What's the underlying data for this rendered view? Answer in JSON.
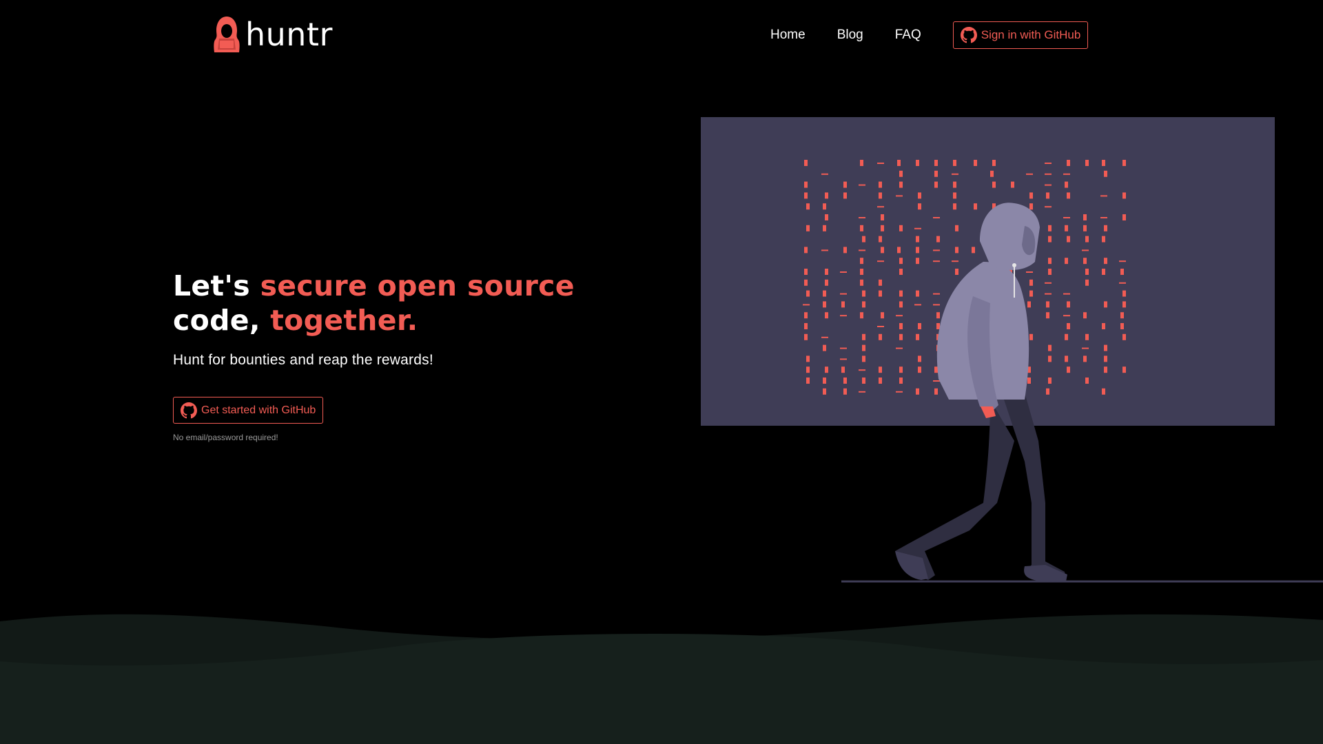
{
  "header": {
    "logo_text": "huntr",
    "logo_icon": "hooded-hacker-icon",
    "nav": {
      "home": "Home",
      "blog": "Blog",
      "faq": "FAQ"
    },
    "signin_label": "Sign in with GitHub",
    "signin_icon": "github-icon"
  },
  "hero": {
    "title_part1": "Let's ",
    "title_accent1": "secure open source",
    "title_part2": "code, ",
    "title_accent2": "together.",
    "subtitle": "Hunt for bounties and reap the rewards!",
    "cta_label": "Get started with GitHub",
    "cta_icon": "github-icon",
    "cta_note": "No email/password required!"
  },
  "illustration": {
    "subject": "hooded-figure-walking",
    "background": "code-matrix-panel"
  },
  "colors": {
    "background": "#000000",
    "accent": "#f25c54",
    "text": "#ffffff",
    "muted": "#9a9a9a",
    "panel": "#3f3d56",
    "hoodie": "#8b87a8",
    "pants": "#2f2e41",
    "wave_dark": "#121a17",
    "wave_light": "#16201c"
  }
}
